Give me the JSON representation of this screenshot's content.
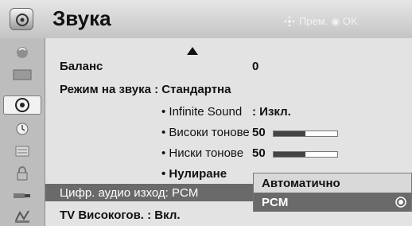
{
  "header": {
    "title": "Звука",
    "hint": "Прем. ◉ OK",
    "hint_icon": "dpad-icon"
  },
  "sidebar": {
    "items": [
      {
        "name": "picture-icon"
      },
      {
        "name": "screen-icon"
      },
      {
        "name": "audio-icon",
        "active": true
      },
      {
        "name": "time-icon"
      },
      {
        "name": "option-icon"
      },
      {
        "name": "lock-icon"
      },
      {
        "name": "input-icon"
      },
      {
        "name": "usb-icon"
      }
    ]
  },
  "menu": {
    "balance": {
      "label": "Баланс",
      "value": "0"
    },
    "sound_mode": {
      "label": "Режим на звука : Стандартна"
    },
    "infinite_sound": {
      "label": "• Infinite Sound",
      "value": ": Изкл."
    },
    "treble": {
      "label": "• Високи тонове",
      "value": "50",
      "level_percent": 50
    },
    "bass": {
      "label": "• Ниски тонове",
      "value": "50",
      "level_percent": 50
    },
    "reset": {
      "label": "• Нулиране"
    },
    "digital_audio": {
      "label": "Цифр. аудио изход: PCM"
    },
    "tv_speaker": {
      "label": "TV Високогов.  : Вкл."
    }
  },
  "popup": {
    "options": [
      "Автоматично",
      "PCM"
    ],
    "selected": "PCM"
  }
}
